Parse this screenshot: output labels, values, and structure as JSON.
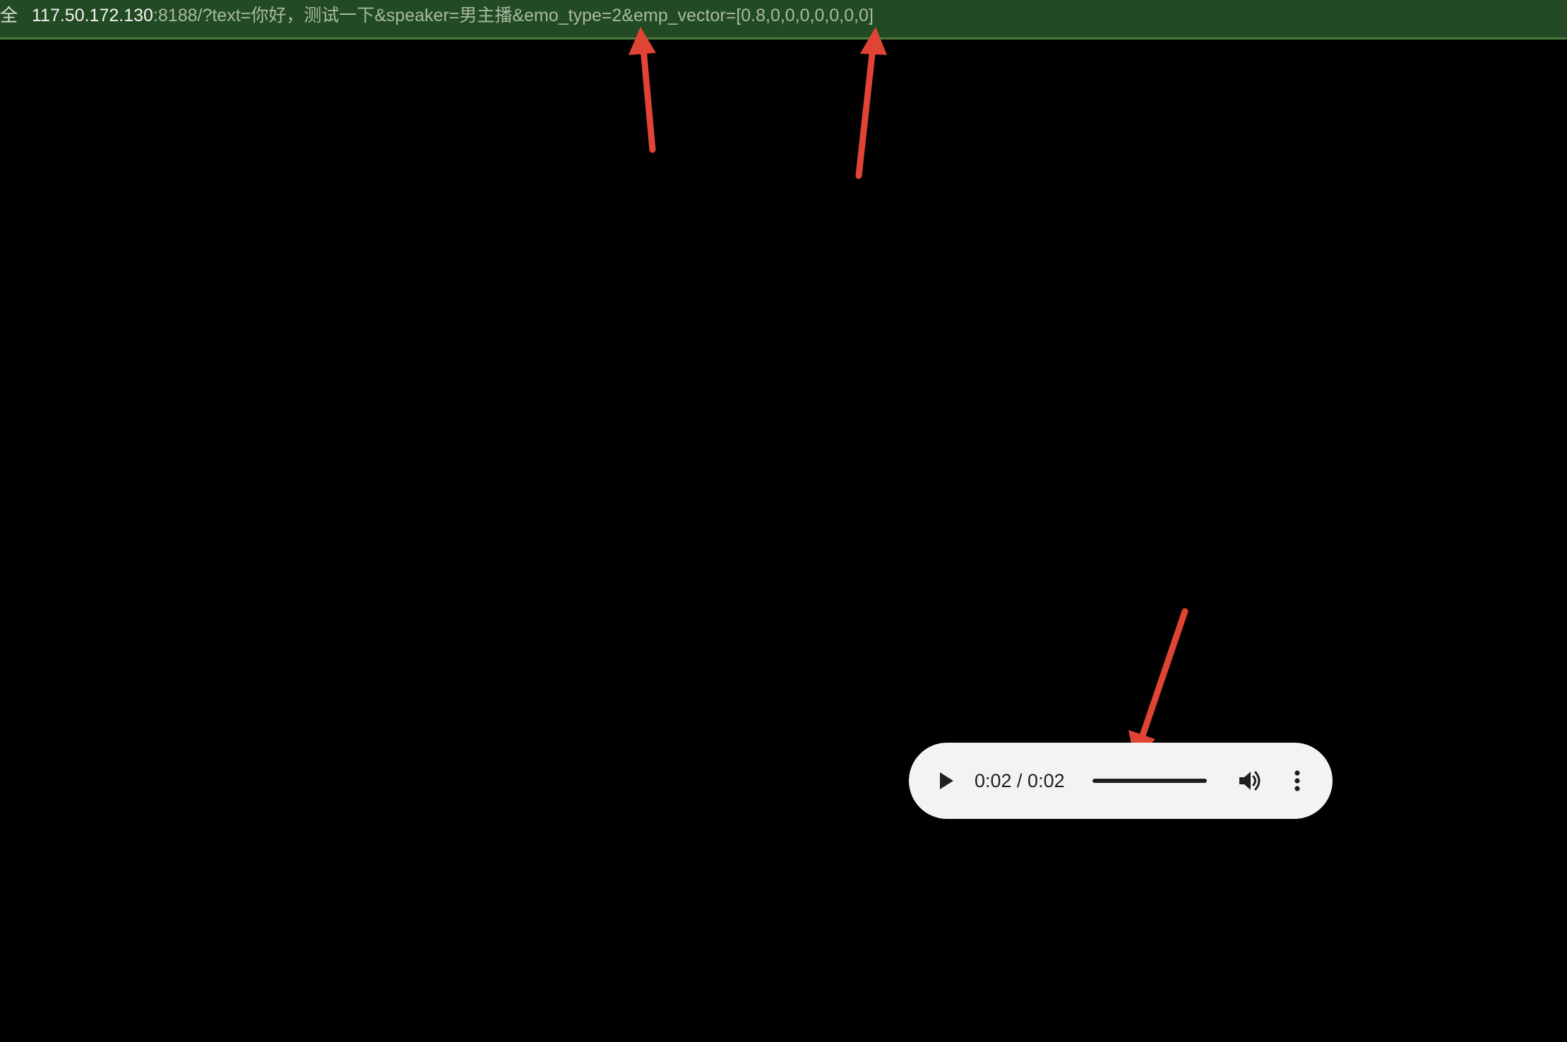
{
  "address_bar": {
    "left_clipped_glyph": "全",
    "url_host": "117.50.172.130",
    "url_rest": ":8188/?text=你好，测试一下&speaker=男主播&emo_type=2&emp_vector=[0.8,0,0,0,0,0,0,0]"
  },
  "audio_player": {
    "time_text": "0:02 / 0:02",
    "progress_fraction": 1.0,
    "play_icon": "play-icon",
    "volume_icon": "volume-icon",
    "more_icon": "more-vert-icon"
  },
  "colors": {
    "page_background": "#000000",
    "address_bar_background": "#234b23",
    "annotation_arrow": "#e04434",
    "player_background": "#f1f3f4",
    "player_foreground": "#1f1f1f"
  }
}
